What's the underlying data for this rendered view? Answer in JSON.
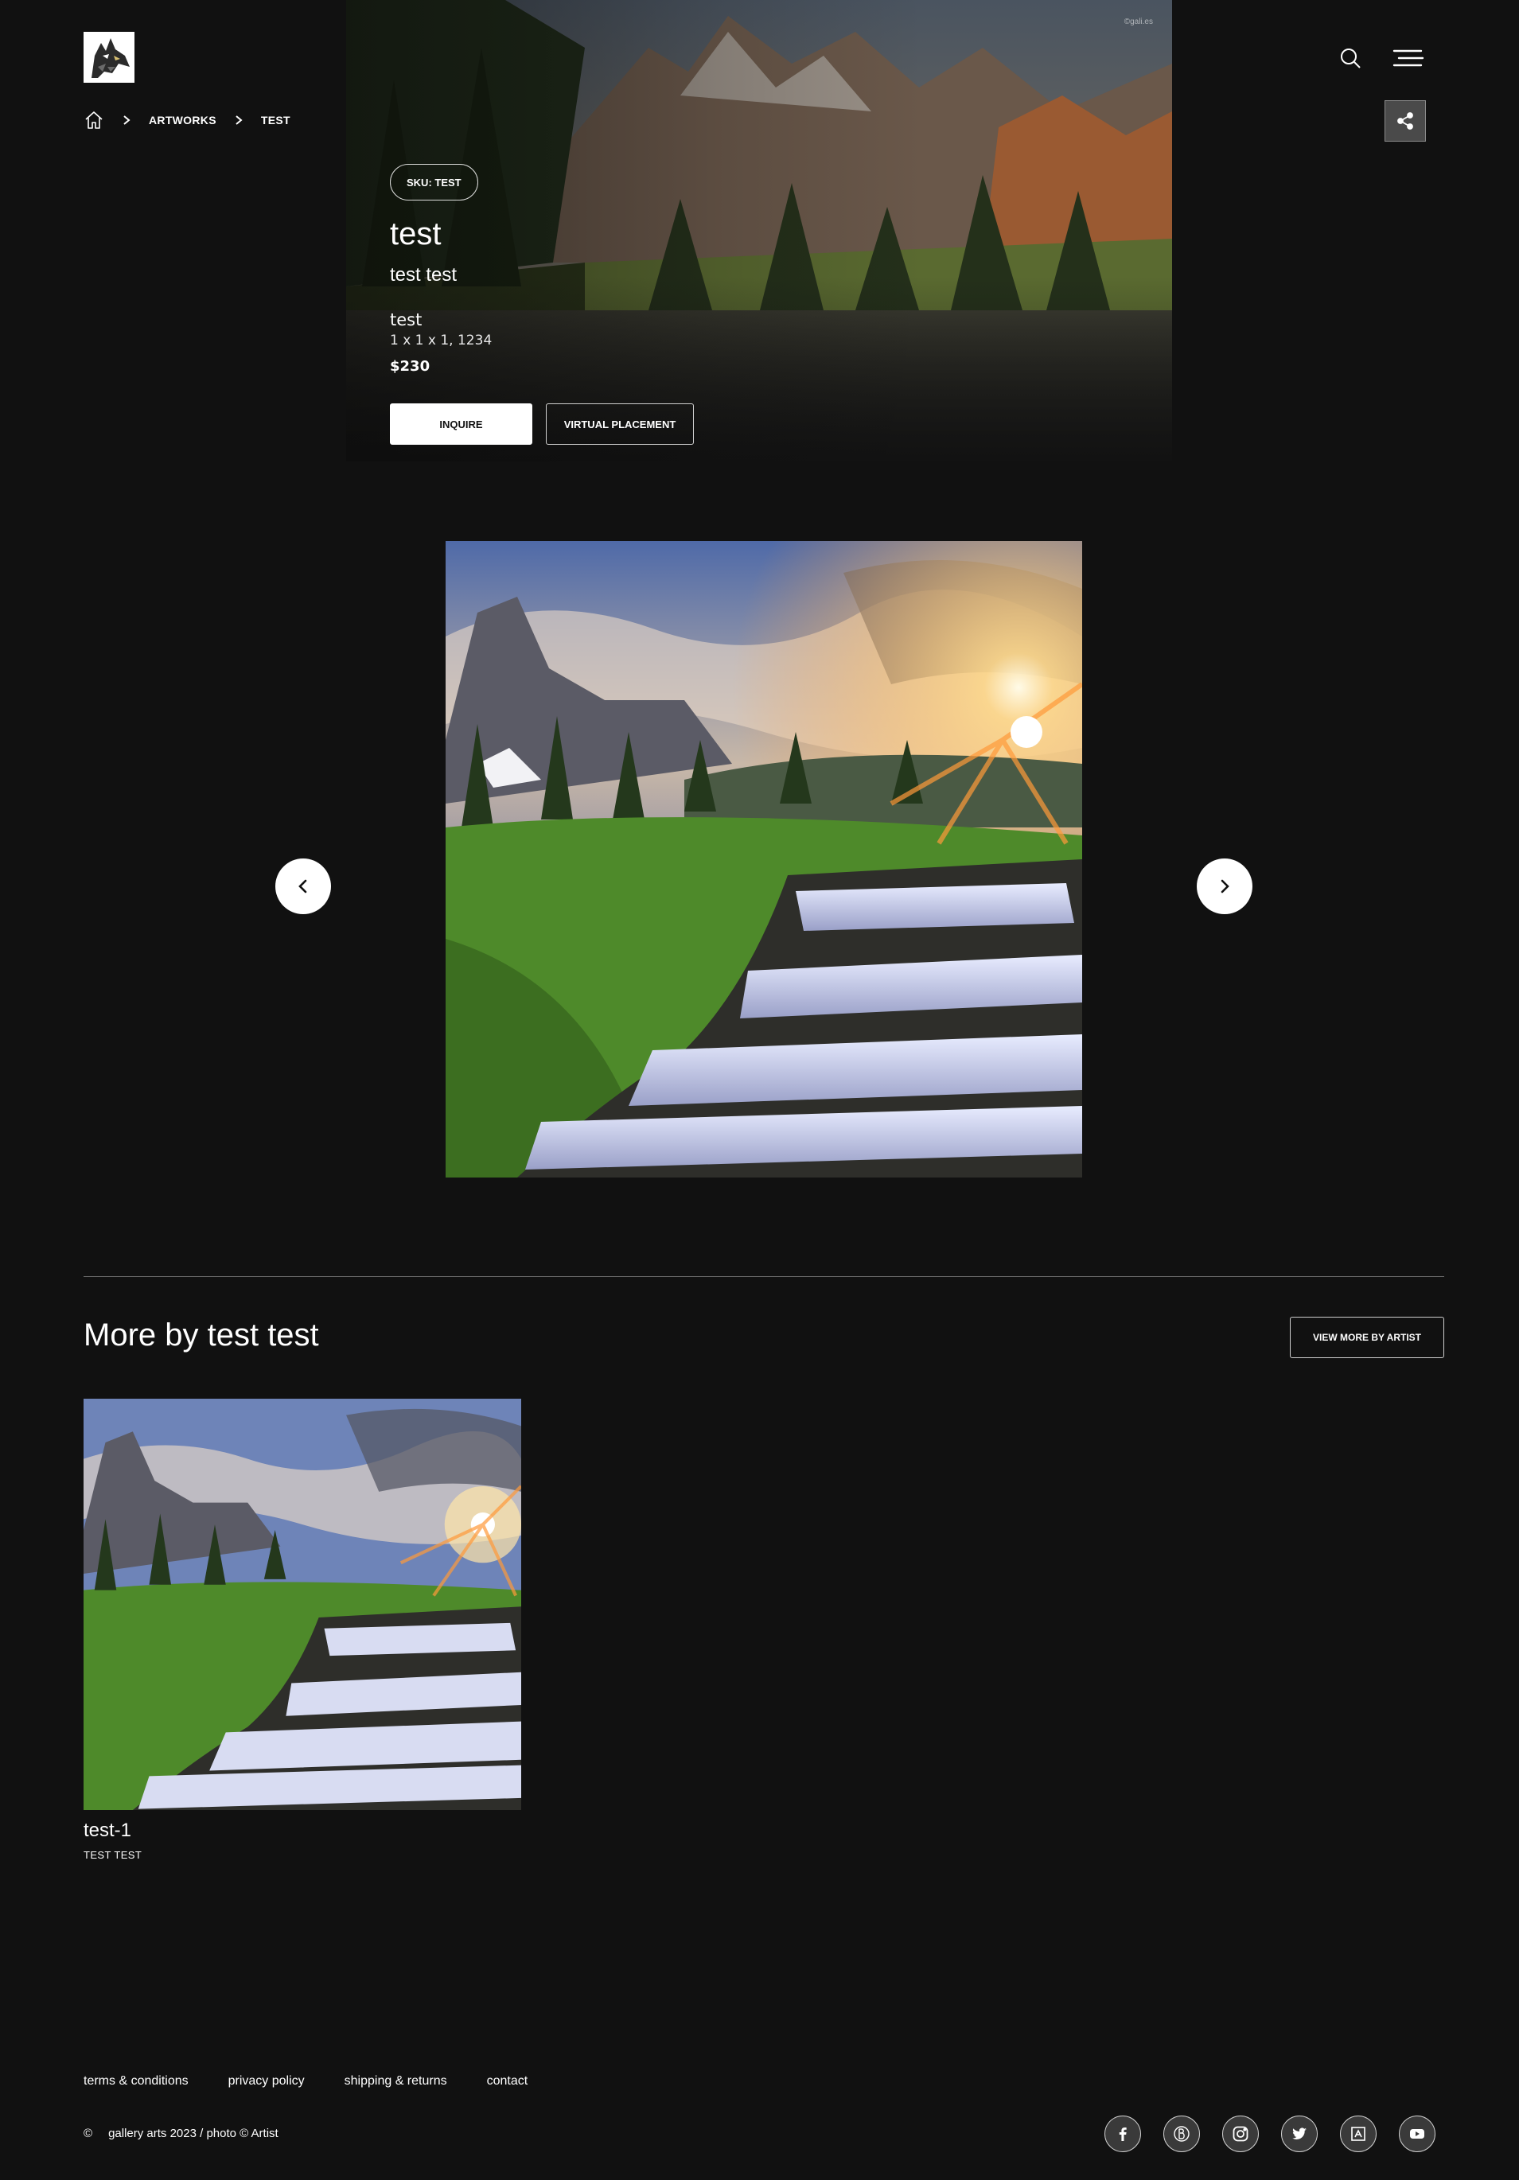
{
  "header": {
    "logo_name": "wolf-logo",
    "breadcrumb": [
      "ARTWORKS",
      "TEST"
    ]
  },
  "artwork": {
    "sku": "SKU: TEST",
    "title": "test",
    "artist": "test test",
    "medium": "test",
    "dimensions": "1 x 1 x 1, 1234",
    "price": "$230",
    "inquire_label": "INQUIRE",
    "virtual_label": "VIRTUAL PLACEMENT",
    "hero_watermark": "©gali.es"
  },
  "more": {
    "heading": "More by test test",
    "view_more_label": "VIEW MORE BY ARTIST",
    "items": [
      {
        "title": "test-1",
        "subtitle": "TEST  TEST"
      }
    ]
  },
  "footer": {
    "links": [
      "terms & conditions",
      "privacy policy",
      "shipping & returns",
      "contact"
    ],
    "copyright_symbol": "©",
    "copyright_text": "gallery arts 2023 / photo © Artist",
    "socials": [
      "facebook-icon",
      "artsy-icon",
      "instagram-icon",
      "twitter-icon",
      "artnet-icon",
      "youtube-icon"
    ]
  },
  "colors": {
    "background": "#111111",
    "text": "#ffffff",
    "button_light": "#ffffff",
    "share_bg": "#4a4a4a"
  }
}
